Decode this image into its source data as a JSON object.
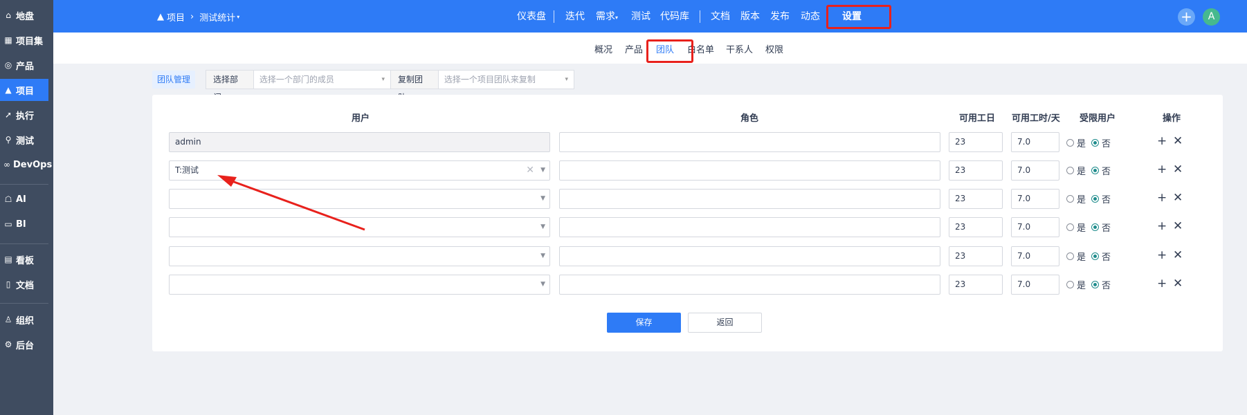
{
  "sidebar": {
    "items": [
      {
        "label": "地盘",
        "icon": "home-icon",
        "glyph": "⌂"
      },
      {
        "label": "项目集",
        "icon": "grid-icon",
        "glyph": "▦"
      },
      {
        "label": "产品",
        "icon": "lightbulb-icon",
        "glyph": "◎"
      },
      {
        "label": "项目",
        "icon": "project-icon",
        "glyph": "Ⓐ"
      },
      {
        "label": "执行",
        "icon": "rocket-icon",
        "glyph": "➚"
      },
      {
        "label": "测试",
        "icon": "search-icon",
        "glyph": "⚲"
      },
      {
        "label": "DevOps",
        "icon": "infinity-icon",
        "glyph": "∞"
      },
      {
        "label": "AI",
        "icon": "robot-icon",
        "glyph": "⌂"
      },
      {
        "label": "BI",
        "icon": "monitor-icon",
        "glyph": "▭"
      },
      {
        "label": "看板",
        "icon": "kanban-icon",
        "glyph": "▤"
      },
      {
        "label": "文档",
        "icon": "doc-icon",
        "glyph": "▯"
      },
      {
        "label": "组织",
        "icon": "users-icon",
        "glyph": "♙"
      },
      {
        "label": "后台",
        "icon": "gear-icon",
        "glyph": "⚙"
      }
    ]
  },
  "topbar": {
    "breadcrumb_root": "项目",
    "breadcrumb_current": "测试统计",
    "nav": [
      "仪表盘",
      "迭代",
      "需求",
      "测试",
      "代码库",
      "文档",
      "版本",
      "发布",
      "动态",
      "设置"
    ],
    "avatar_letter": "A",
    "plus_glyph": "+"
  },
  "subnav": [
    "概况",
    "产品",
    "团队",
    "白名单",
    "干系人",
    "权限"
  ],
  "toolbar": {
    "team_manage": "团队管理",
    "dept_label": "选择部门",
    "dept_placeholder": "选择一个部门的成员",
    "copy_label": "复制团队",
    "copy_placeholder": "选择一个项目团队来复制"
  },
  "table": {
    "headers": [
      "用户",
      "角色",
      "可用工日",
      "可用工时/天",
      "受限用户",
      "操作"
    ],
    "yes": "是",
    "no": "否",
    "rows": [
      {
        "user": "admin",
        "role": "",
        "days": "23",
        "hours": "7.0"
      },
      {
        "user": "T:测试",
        "role": "",
        "days": "23",
        "hours": "7.0"
      },
      {
        "user": "",
        "role": "",
        "days": "23",
        "hours": "7.0"
      },
      {
        "user": "",
        "role": "",
        "days": "23",
        "hours": "7.0"
      },
      {
        "user": "",
        "role": "",
        "days": "23",
        "hours": "7.0"
      },
      {
        "user": "",
        "role": "",
        "days": "23",
        "hours": "7.0"
      }
    ]
  },
  "buttons": {
    "save": "保存",
    "back": "返回"
  },
  "colors": {
    "accent": "#2e7bf6",
    "sidebar": "#3f4c60",
    "highlight": "#e8211c",
    "radio": "#1f8c8c"
  }
}
